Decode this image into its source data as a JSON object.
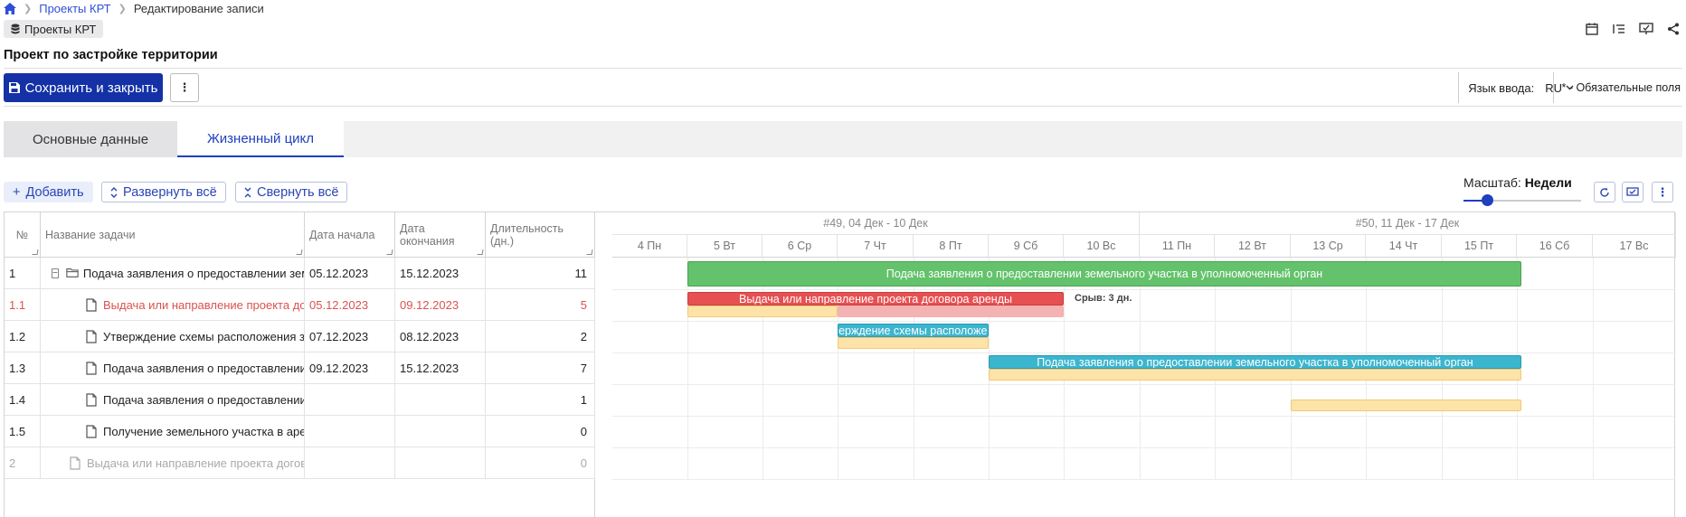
{
  "breadcrumb": {
    "home_icon": "home-icon",
    "projects": "Проекты КРТ",
    "current": "Редактирование записи"
  },
  "chip": {
    "label": "Проекты КРТ",
    "icon": "database-icon"
  },
  "title": "Проект по застройке территории",
  "toolbar": {
    "save_label": "Сохранить и закрыть",
    "more_label": "⋮"
  },
  "lang": {
    "label": "Язык ввода:",
    "value": "RU"
  },
  "required_note": "* - Обязательные поля",
  "tabs": [
    {
      "label": "Основные данные"
    },
    {
      "label": "Жизненный цикл"
    }
  ],
  "actions": {
    "add": "Добавить",
    "expand": "Развернуть всё",
    "collapse": "Свернуть всё"
  },
  "scale": {
    "label": "Масштаб:",
    "value": "Недели",
    "level": 0.18
  },
  "grid": {
    "headers": {
      "num": "№",
      "name": "Название задачи",
      "start": "Дата начала",
      "end": "Дата окончания",
      "duration": "Длительность (дн.)"
    },
    "rows": [
      {
        "num": "1",
        "name": "Подача заявления о предоставлении земельного участка в уполномоченный орган",
        "start": "05.12.2023",
        "end": "15.12.2023",
        "duration": "11"
      },
      {
        "num": "1.1",
        "name": "Выдача или направление проекта договора аренды",
        "start": "05.12.2023",
        "end": "09.12.2023",
        "duration": "5"
      },
      {
        "num": "1.2",
        "name": "Утверждение схемы расположения земельного участка",
        "start": "07.12.2023",
        "end": "08.12.2023",
        "duration": "2"
      },
      {
        "num": "1.3",
        "name": "Подача заявления о предоставлении земельного участка в уполномоченный орган",
        "start": "09.12.2023",
        "end": "15.12.2023",
        "duration": "7"
      },
      {
        "num": "1.4",
        "name": "Подача заявления о предоставлении земельного участка",
        "start": "",
        "end": "",
        "duration": "1"
      },
      {
        "num": "1.5",
        "name": "Получение земельного участка в аренду",
        "start": "",
        "end": "",
        "duration": "0"
      },
      {
        "num": "2",
        "name": "Выдача или направление проекта договора аренды",
        "start": "",
        "end": "",
        "duration": "0"
      }
    ]
  },
  "gantt": {
    "weeks": [
      "#49, 04 Дек - 10 Дек",
      "#50, 11 Дек - 17 Дек"
    ],
    "days": [
      "4 Пн",
      "5 Вт",
      "6 Ср",
      "7 Чт",
      "8 Пт",
      "9 Сб",
      "10 Вс",
      "11 Пн",
      "12 Вт",
      "13 Ср",
      "14 Чт",
      "15 Пт",
      "16 Сб",
      "17 Вс"
    ],
    "bars": {
      "b1": "Подача заявления о предоставлении земельного участка в уполномоченный орган",
      "b2": "Выдача или направление проекта договора аренды",
      "b3": "Утверждение схемы расположения",
      "b4": "Подача заявления о предоставлении земельного участка в уполномоченный орган"
    },
    "delay": "Срыв: 3 дн.",
    "colors": {
      "green": "#63c26b",
      "red": "#e75052",
      "blue": "#3cb5cf",
      "baseline": "#fde3a8"
    }
  }
}
